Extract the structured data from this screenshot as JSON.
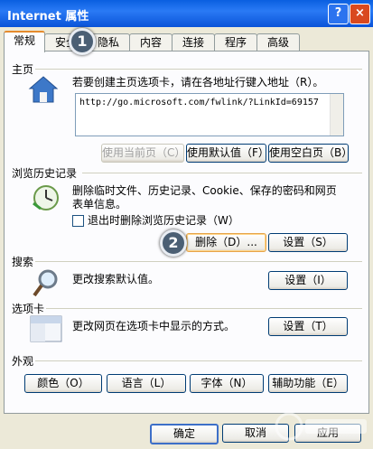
{
  "window": {
    "title": "Internet 属性",
    "help": "?",
    "close": "×"
  },
  "tabs": [
    "常规",
    "安全",
    "隐私",
    "内容",
    "连接",
    "程序",
    "高级"
  ],
  "home": {
    "title": "主页",
    "desc": "若要创建主页选项卡，请在各地址行键入地址（R）。",
    "url": "http://go.microsoft.com/fwlink/?LinkId=69157",
    "buttons": {
      "current": "使用当前页（C）",
      "default": "使用默认值（F）",
      "blank": "使用空白页（B）"
    }
  },
  "history": {
    "title": "浏览历史记录",
    "desc": "删除临时文件、历史记录、Cookie、保存的密码和网页表单信息。",
    "checkbox": "退出时删除浏览历史记录（W）",
    "delete_button": "删除（D）...",
    "settings_button": "设置（S）"
  },
  "search": {
    "title": "搜索",
    "desc": "更改搜索默认值。",
    "settings_button": "设置（I）"
  },
  "tabsection": {
    "title": "选项卡",
    "desc": "更改网页在选项卡中显示的方式。",
    "settings_button": "设置（T）"
  },
  "appearance": {
    "title": "外观",
    "buttons": {
      "colors": "颜色（O）",
      "languages": "语言（L）",
      "fonts": "字体（N）",
      "accessibility": "辅助功能（E）"
    }
  },
  "bottom": {
    "ok": "确定",
    "cancel": "取消",
    "apply": "应用"
  },
  "callouts": {
    "one": "1",
    "two": "2"
  },
  "colors": {
    "titlebar": "#0a5fe0",
    "accent_tab": "#e68b2c",
    "callout": "#4b5f74"
  }
}
